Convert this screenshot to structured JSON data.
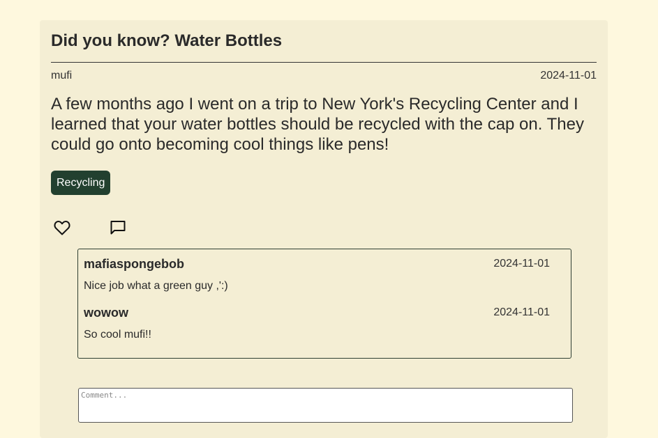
{
  "post": {
    "title": "Did you know? Water Bottles",
    "author": "mufi",
    "date": "2024-11-01",
    "body": "A few months ago I went on a trip to New York's Recycling Center and I learned that your water bottles should be recycled with the cap on. They could go onto becoming cool things like pens!",
    "tag": "Recycling"
  },
  "actions": {
    "like_icon": "heart-icon",
    "comment_icon": "speech-bubble-icon"
  },
  "comments": [
    {
      "author": "mafiaspongebob",
      "date": "2024-11-01",
      "text": "Nice job what a green guy ,':)"
    },
    {
      "author": "wowow",
      "date": "2024-11-01",
      "text": "So cool mufi!!"
    }
  ],
  "comment_form": {
    "placeholder": "Comment...",
    "value": ""
  },
  "colors": {
    "page_background": "#fef8de",
    "card_background": "#f4eed4",
    "tag_background": "#22402f"
  }
}
